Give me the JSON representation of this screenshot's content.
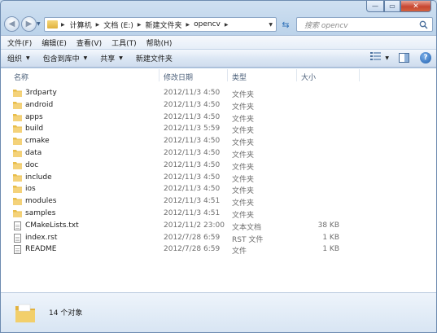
{
  "window": {
    "minimize_glyph": "—",
    "maximize_glyph": "▭",
    "close_glyph": "✕"
  },
  "address_bar": {
    "breadcrumbs": [
      "计算机",
      "文档 (E:)",
      "新建文件夹",
      "opencv"
    ],
    "back_glyph": "◀",
    "forward_glyph": "▶",
    "refresh_glyph": "⇆"
  },
  "search": {
    "placeholder": "搜索 opencv"
  },
  "menu": {
    "items": [
      "文件(F)",
      "编辑(E)",
      "查看(V)",
      "工具(T)",
      "帮助(H)"
    ]
  },
  "toolbar": {
    "organize": "组织",
    "include_in_library": "包含到库中",
    "share": "共享",
    "new_folder": "新建文件夹",
    "help_glyph": "?"
  },
  "columns": {
    "name": "名称",
    "modified": "修改日期",
    "type": "类型",
    "size": "大小"
  },
  "files": [
    {
      "name": "3rdparty",
      "date": "2012/11/3 4:50",
      "type": "文件夹",
      "size": "",
      "kind": "folder"
    },
    {
      "name": "android",
      "date": "2012/11/3 4:50",
      "type": "文件夹",
      "size": "",
      "kind": "folder"
    },
    {
      "name": "apps",
      "date": "2012/11/3 4:50",
      "type": "文件夹",
      "size": "",
      "kind": "folder"
    },
    {
      "name": "build",
      "date": "2012/11/3 5:59",
      "type": "文件夹",
      "size": "",
      "kind": "folder"
    },
    {
      "name": "cmake",
      "date": "2012/11/3 4:50",
      "type": "文件夹",
      "size": "",
      "kind": "folder"
    },
    {
      "name": "data",
      "date": "2012/11/3 4:50",
      "type": "文件夹",
      "size": "",
      "kind": "folder"
    },
    {
      "name": "doc",
      "date": "2012/11/3 4:50",
      "type": "文件夹",
      "size": "",
      "kind": "folder"
    },
    {
      "name": "include",
      "date": "2012/11/3 4:50",
      "type": "文件夹",
      "size": "",
      "kind": "folder"
    },
    {
      "name": "ios",
      "date": "2012/11/3 4:50",
      "type": "文件夹",
      "size": "",
      "kind": "folder"
    },
    {
      "name": "modules",
      "date": "2012/11/3 4:51",
      "type": "文件夹",
      "size": "",
      "kind": "folder"
    },
    {
      "name": "samples",
      "date": "2012/11/3 4:51",
      "type": "文件夹",
      "size": "",
      "kind": "folder"
    },
    {
      "name": "CMakeLists.txt",
      "date": "2012/11/2 23:00",
      "type": "文本文档",
      "size": "38 KB",
      "kind": "file"
    },
    {
      "name": "index.rst",
      "date": "2012/7/28 6:59",
      "type": "RST 文件",
      "size": "1 KB",
      "kind": "file"
    },
    {
      "name": "README",
      "date": "2012/7/28 6:59",
      "type": "文件",
      "size": "1 KB",
      "kind": "file"
    }
  ],
  "details_pane": {
    "item_count": "14 个对象"
  },
  "colors": {
    "folder": "#e8bd4a",
    "accent": "#2c6fb7"
  }
}
